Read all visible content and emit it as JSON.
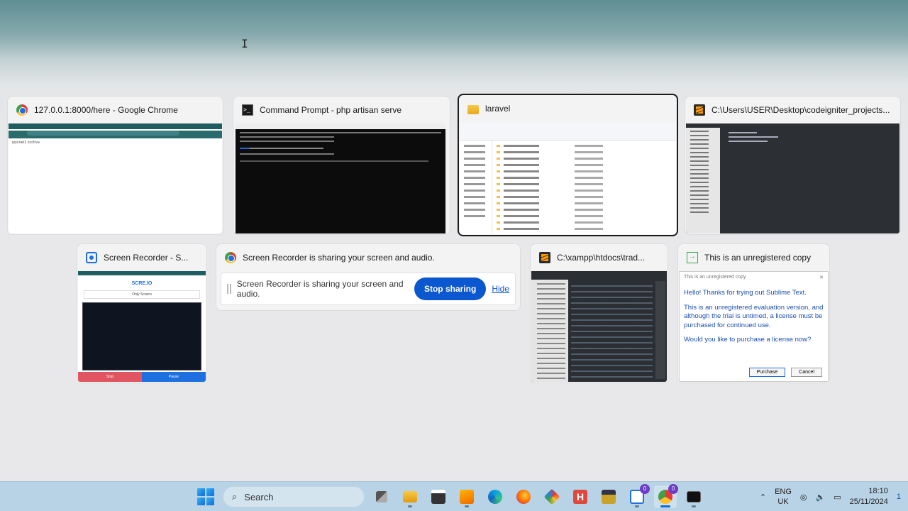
{
  "windows": {
    "chrome": {
      "title": "127.0.0.1:8000/here - Google Chrome",
      "thumb_text": " spicnel1  zcctlvs",
      "icon": "chrome-icon"
    },
    "cmd": {
      "title": "Command Prompt - php  artisan serve",
      "icon": "command-prompt-icon"
    },
    "explorer": {
      "title": "laravel",
      "icon": "folder-icon"
    },
    "sublime": {
      "title": "C:\\Users\\USER\\Desktop\\codeigniter_projects...",
      "icon": "sublime-text-icon"
    },
    "recorder": {
      "title": "Screen Recorder - S...",
      "logo": "SCRE.IO",
      "share_label": "Only Screen",
      "stop": "Stop",
      "pause": "Pause",
      "icon": "screen-recorder-icon"
    },
    "sharing": {
      "title": "Screen Recorder is sharing your screen and audio.",
      "message": "Screen Recorder is sharing your screen and audio.",
      "stop_button": "Stop sharing",
      "hide_link": "Hide",
      "icon": "chrome-icon"
    },
    "xampp": {
      "title": "C:\\xampp\\htdocs\\trad...",
      "icon": "sublime-text-icon"
    },
    "dialog": {
      "title": "This is an unregistered copy",
      "dialog_title": "This is an unregistered copy",
      "line1": "Hello! Thanks for trying out Sublime Text.",
      "line2": "This is an unregistered evaluation version, and although the trial is untimed, a license must be purchased for continued use.",
      "line3": "Would you like to purchase a license now?",
      "purchase": "Purchase",
      "cancel": "Cancel",
      "icon": "arrow-box-icon"
    }
  },
  "taskbar": {
    "search_placeholder": "Search",
    "apps": [
      "task-view",
      "file-explorer",
      "clapper",
      "sublime-text",
      "edge",
      "firefox",
      "vscode",
      "app-h",
      "app-bag",
      "screen-recorder",
      "chrome",
      "terminal"
    ],
    "recorder_badge": "0",
    "chrome_badge": "0",
    "lang_line1": "ENG",
    "lang_line2": "UK",
    "time": "18:10",
    "date": "25/11/2024",
    "notifications": "1"
  },
  "colors": {
    "accent": "#0b57d0",
    "taskbar": "#b9d3e6"
  }
}
